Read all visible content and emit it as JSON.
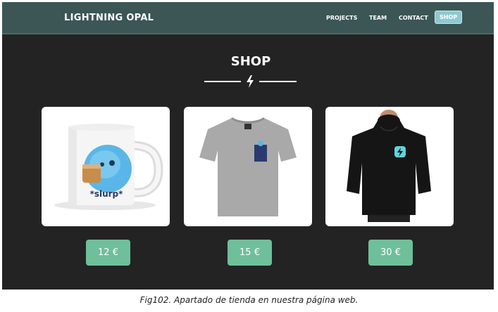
{
  "nav": {
    "brand": "LIGHTNING OPAL",
    "links": [
      "PROJECTS",
      "TEAM",
      "CONTACT",
      "SHOP"
    ],
    "active": "SHOP"
  },
  "shop": {
    "title": "SHOP",
    "divider_icon": "lightning-bolt-icon",
    "products": [
      {
        "image": "mug-image",
        "image_text": "*slurp*",
        "price": "12 €"
      },
      {
        "image": "tshirt-image",
        "price": "15 €"
      },
      {
        "image": "hoodie-image",
        "price": "30 €"
      }
    ]
  },
  "colors": {
    "navbar": "#3b5655",
    "background": "#232323",
    "active_tab": "#8fc9d1",
    "price_button": "#6fbf9a"
  },
  "caption": "Fig102. Apartado de tienda en nuestra página web."
}
